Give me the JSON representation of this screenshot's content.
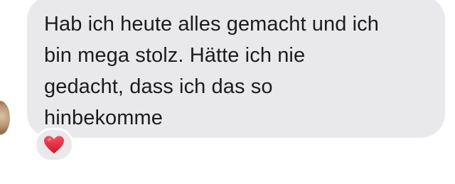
{
  "message": {
    "text": "Hab ich heute alles gemacht und ich\nbin mega stolz. Hätte ich nie\ngedacht, dass ich das so\nhinbekomme"
  },
  "reaction": {
    "icon": "heart-icon",
    "color": "#e0212f"
  },
  "colors": {
    "bubble_background": "#e9e9eb",
    "text": "#1c1c1e"
  }
}
